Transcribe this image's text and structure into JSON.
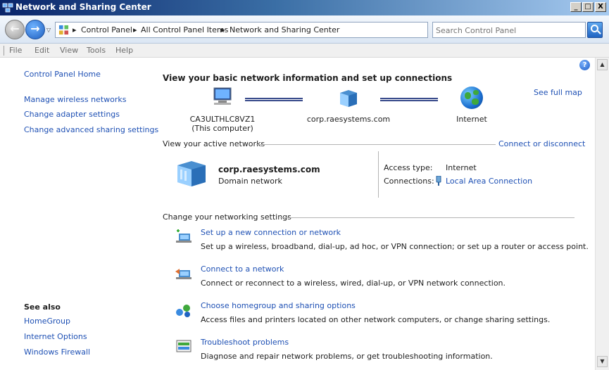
{
  "window": {
    "title": "Network and Sharing Center",
    "buttons": {
      "minimize": "_",
      "maximize": "□",
      "close": "X"
    }
  },
  "address": {
    "crumbs": [
      "Control Panel",
      "All Control Panel Items",
      "Network and Sharing Center"
    ],
    "separator": "▸"
  },
  "search": {
    "placeholder": "Search Control Panel"
  },
  "menu": [
    "File",
    "Edit",
    "View",
    "Tools",
    "Help"
  ],
  "sidebar": {
    "home": "Control Panel Home",
    "links": [
      "Manage wireless networks",
      "Change adapter settings",
      "Change advanced sharing settings"
    ],
    "see_also_title": "See also",
    "see_also": [
      "HomeGroup",
      "Internet Options",
      "Windows Firewall"
    ]
  },
  "main": {
    "heading": "View your basic network information and set up connections",
    "see_full_map": "See full map",
    "map": {
      "computer_name": "CA3ULTHLC8VZ1",
      "computer_sub": "(This computer)",
      "domain": "corp.raesystems.com",
      "internet": "Internet"
    },
    "active_networks_label": "View your active networks",
    "connect_disconnect": "Connect or disconnect",
    "active": {
      "name": "corp.raesystems.com",
      "type": "Domain network",
      "access_type_label": "Access type:",
      "access_type_value": "Internet",
      "connections_label": "Connections:",
      "connections_value": "Local Area Connection"
    },
    "change_settings_label": "Change your networking settings",
    "tasks": [
      {
        "title": "Set up a new connection or network",
        "desc": "Set up a wireless, broadband, dial-up, ad hoc, or VPN connection; or set up a router or access point."
      },
      {
        "title": "Connect to a network",
        "desc": "Connect or reconnect to a wireless, wired, dial-up, or VPN network connection."
      },
      {
        "title": "Choose homegroup and sharing options",
        "desc": "Access files and printers located on other network computers, or change sharing settings."
      },
      {
        "title": "Troubleshoot problems",
        "desc": "Diagnose and repair network problems, or get troubleshooting information."
      }
    ]
  },
  "colors": {
    "link": "#1e50b4",
    "titlebar": "#0a246a"
  }
}
